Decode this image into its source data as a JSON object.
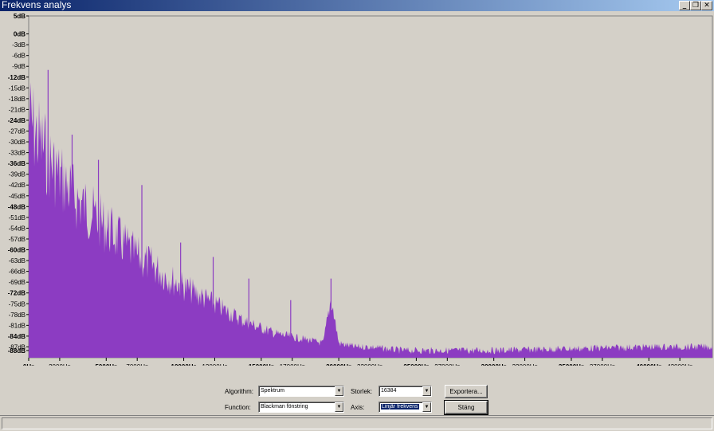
{
  "window": {
    "title": "Frekvens analys",
    "buttons": {
      "minimize": "_",
      "restore": "❐",
      "close": "✕"
    }
  },
  "chart_data": {
    "type": "area",
    "title": "",
    "xlabel": "",
    "ylabel": "",
    "xlim": [
      0,
      44100
    ],
    "ylim": [
      -90,
      5
    ],
    "fill_color": "#8c3cc2",
    "background": "#d4d0c8",
    "grid": false,
    "y_ticks": [
      "5dB",
      "0dB",
      "-3dB",
      "-6dB",
      "-9dB",
      "-12dB",
      "-15dB",
      "-18dB",
      "-21dB",
      "-24dB",
      "-27dB",
      "-30dB",
      "-33dB",
      "-36dB",
      "-39dB",
      "-42dB",
      "-45dB",
      "-48dB",
      "-51dB",
      "-54dB",
      "-57dB",
      "-60dB",
      "-63dB",
      "-66dB",
      "-69dB",
      "-72dB",
      "-75dB",
      "-78dB",
      "-81dB",
      "-84dB",
      "-87dB",
      "-88dB"
    ],
    "y_tick_values": [
      5,
      0,
      -3,
      -6,
      -9,
      -12,
      -15,
      -18,
      -21,
      -24,
      -27,
      -30,
      -33,
      -36,
      -39,
      -42,
      -45,
      -48,
      -51,
      -54,
      -57,
      -60,
      -63,
      -66,
      -69,
      -72,
      -75,
      -78,
      -81,
      -84,
      -87,
      -88
    ],
    "y_tick_bold": [
      "5dB",
      "0dB",
      "-12dB",
      "-24dB",
      "-36dB",
      "-48dB",
      "-60dB",
      "-72dB",
      "-84dB",
      "-88dB"
    ],
    "x_ticks": [
      {
        "label": "0Hz",
        "value": 0,
        "bold": true
      },
      {
        "label": "2000Hz",
        "value": 2000,
        "bold": false
      },
      {
        "label": "5000Hz",
        "value": 5000,
        "bold": true
      },
      {
        "label": "7000Hz",
        "value": 7000,
        "bold": false
      },
      {
        "label": "10000Hz",
        "value": 10000,
        "bold": true
      },
      {
        "label": "12000Hz",
        "value": 12000,
        "bold": false
      },
      {
        "label": "15000Hz",
        "value": 15000,
        "bold": true
      },
      {
        "label": "17000Hz",
        "value": 17000,
        "bold": false
      },
      {
        "label": "20000Hz",
        "value": 20000,
        "bold": true
      },
      {
        "label": "22000Hz",
        "value": 22000,
        "bold": false
      },
      {
        "label": "25000Hz",
        "value": 25000,
        "bold": true
      },
      {
        "label": "27000Hz",
        "value": 27000,
        "bold": false
      },
      {
        "label": "30000Hz",
        "value": 30000,
        "bold": true
      },
      {
        "label": "32000Hz",
        "value": 32000,
        "bold": false
      },
      {
        "label": "35000Hz",
        "value": 35000,
        "bold": true
      },
      {
        "label": "37000Hz",
        "value": 37000,
        "bold": false
      },
      {
        "label": "40000Hz",
        "value": 40000,
        "bold": true
      },
      {
        "label": "42000Hz",
        "value": 42000,
        "bold": false
      }
    ],
    "series": [
      {
        "x": [
          0,
          500,
          1000,
          1500,
          2000,
          3000,
          4000,
          5000,
          6000,
          7000,
          8000,
          9000,
          10000,
          11000,
          12000,
          13000,
          14000,
          15000,
          16000,
          17000,
          18000,
          19000,
          19500,
          20000,
          21000,
          22000,
          24000,
          26000,
          30000,
          35000,
          40000,
          44100
        ],
        "y": [
          -9,
          -15,
          -20,
          -25,
          -29,
          -36,
          -41,
          -46,
          -51,
          -56,
          -59,
          -63,
          -66,
          -69,
          -72,
          -75,
          -78,
          -80,
          -82,
          -83,
          -84,
          -85,
          -70,
          -85,
          -86,
          -86,
          -87,
          -87,
          -87,
          -86.5,
          -86,
          -86
        ],
        "peaks": [
          [
            1250,
            -10
          ],
          [
            2800,
            -28
          ],
          [
            4500,
            -35
          ],
          [
            7300,
            -42
          ],
          [
            9800,
            -58
          ],
          [
            11900,
            -62
          ],
          [
            14200,
            -68
          ],
          [
            16900,
            -74
          ],
          [
            19500,
            -68
          ]
        ]
      }
    ]
  },
  "controls": {
    "algorithm_label": "Algorithm:",
    "algorithm_value": "Spektrum",
    "function_label": "Function:",
    "function_value": "Blackman fönstring",
    "size_label": "Storlek:",
    "size_value": "16384",
    "axis_label": "Axis:",
    "axis_value": "Linjär frekvens",
    "export_label": "Exportera...",
    "close_label": "Stäng"
  }
}
